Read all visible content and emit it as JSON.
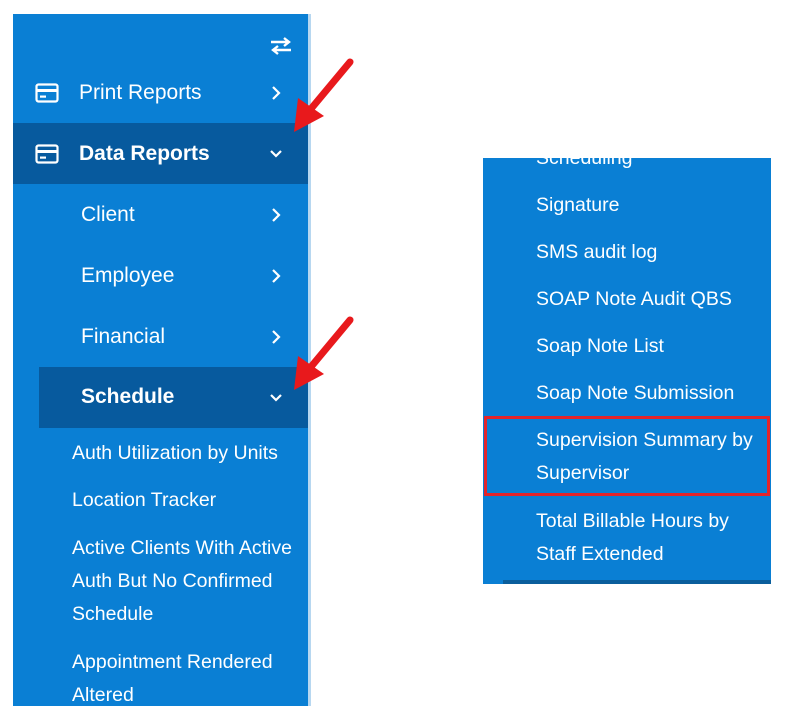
{
  "sidebar": {
    "toggle_icon": "swap-arrows-icon",
    "print_reports": {
      "label": "Print Reports",
      "icon": "card-icon",
      "chevron": "chevron-right-icon"
    },
    "data_reports": {
      "label": "Data Reports",
      "icon": "card-icon",
      "chevron": "chevron-down-icon"
    },
    "submenu": [
      {
        "label": "Client"
      },
      {
        "label": "Employee"
      },
      {
        "label": "Financial"
      }
    ],
    "schedule": {
      "label": "Schedule",
      "chevron": "chevron-down-icon"
    },
    "schedule_items": [
      {
        "label": "Auth Utilization by Units"
      },
      {
        "label": "Location Tracker"
      },
      {
        "label": "Active Clients With Active Auth But No Confirmed Schedule"
      },
      {
        "label": "Appointment Rendered Altered"
      }
    ]
  },
  "panel": {
    "items": [
      {
        "label": "Scheduling"
      },
      {
        "label": "Signature"
      },
      {
        "label": "SMS audit log"
      },
      {
        "label": "SOAP Note Audit QBS"
      },
      {
        "label": "Soap Note List"
      },
      {
        "label": "Soap Note Submission"
      },
      {
        "label": "Supervision Summary by Supervisor"
      },
      {
        "label": "Total Billable Hours by Staff Extended"
      }
    ],
    "highlighted_item": "Supervision Summary by Supervisor"
  },
  "colors": {
    "sidebar_bg": "#0a7fd4",
    "active_bg": "#075a9e",
    "text": "#ffffff",
    "highlight_border": "#e3242b",
    "arrow": "#e8191c"
  }
}
